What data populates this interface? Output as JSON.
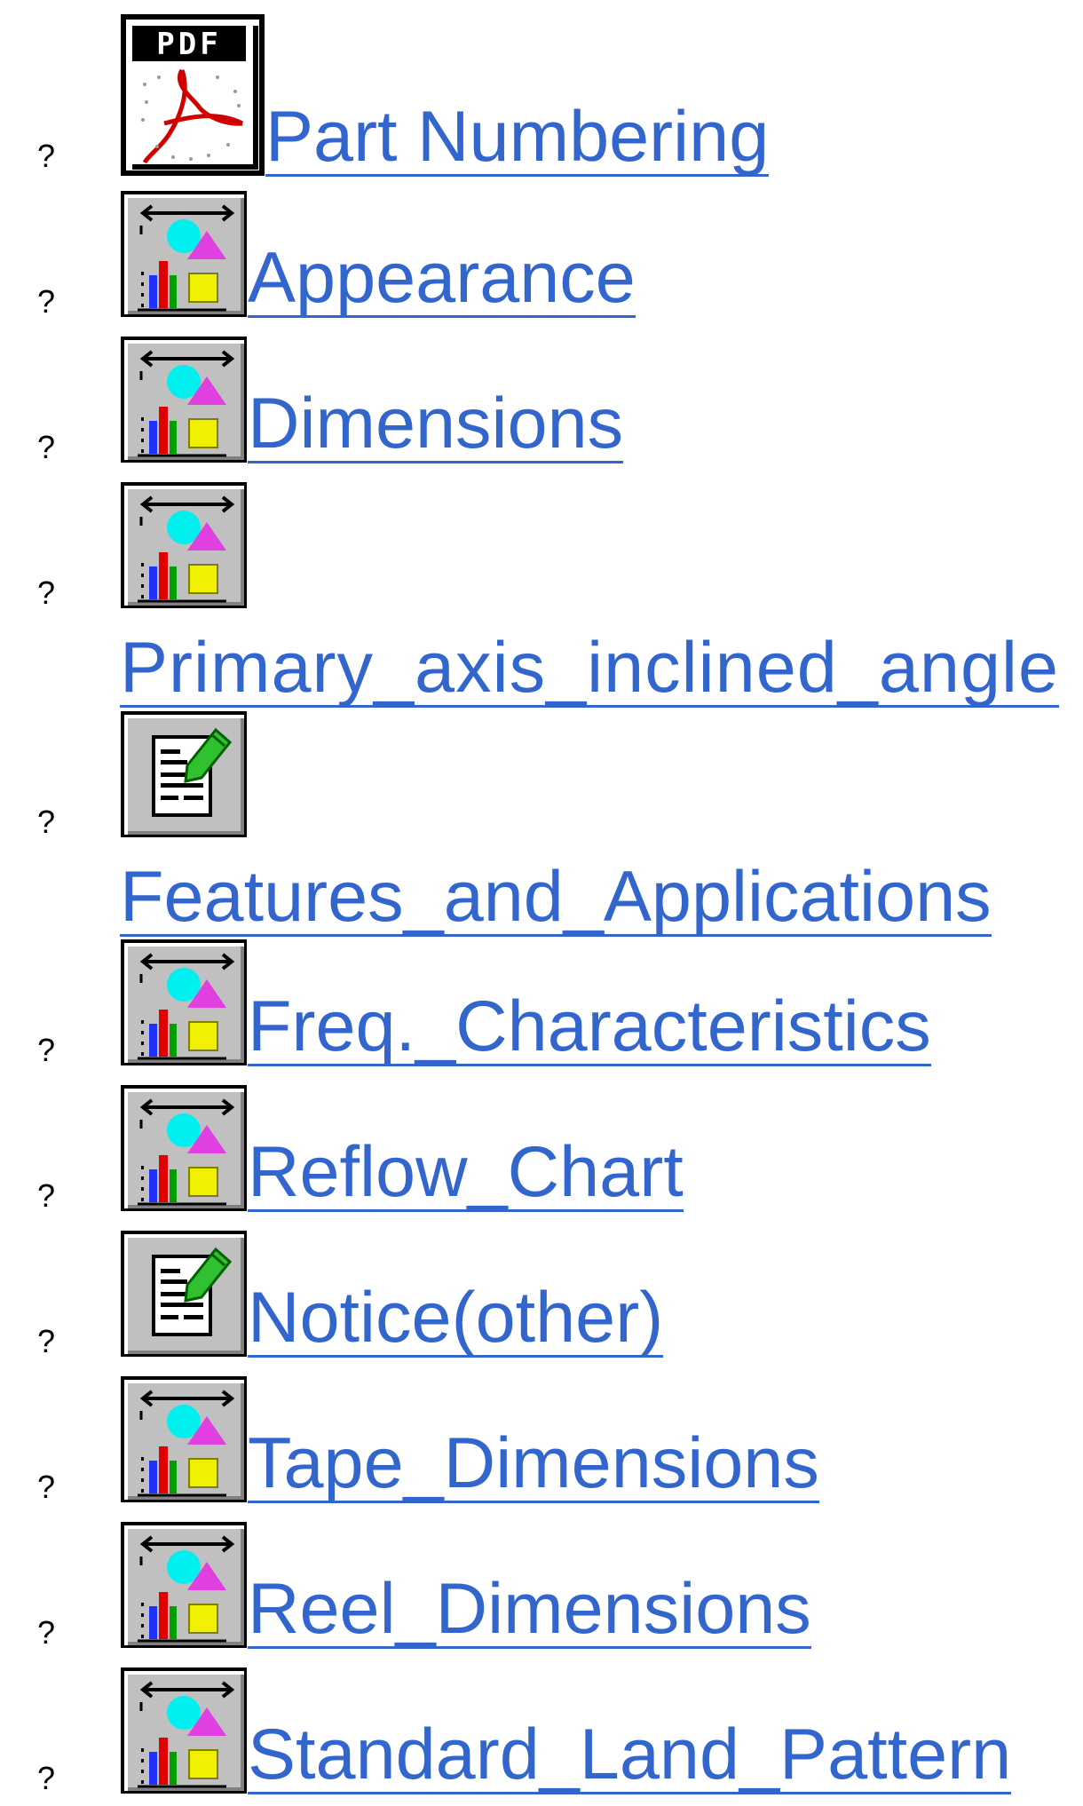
{
  "colors": {
    "link": "#3366cc",
    "bullet": "#000000",
    "icon_face": "#c0c0c0"
  },
  "items": [
    {
      "bullet": "?",
      "icon": "pdf-icon",
      "label": " Part Numbering"
    },
    {
      "bullet": "?",
      "icon": "chart-icon",
      "label": " Appearance"
    },
    {
      "bullet": "?",
      "icon": "chart-icon",
      "label": " Dimensions"
    },
    {
      "bullet": "?",
      "icon": "chart-icon",
      "label": "Primary_axis_inclined_angle"
    },
    {
      "bullet": "?",
      "icon": "document-edit-icon",
      "label": "Features_and_Applications "
    },
    {
      "bullet": "?",
      "icon": "chart-icon",
      "label": " Freq._Characteristics "
    },
    {
      "bullet": "?",
      "icon": "chart-icon",
      "label": " Reflow_Chart"
    },
    {
      "bullet": "?",
      "icon": "document-edit-icon",
      "label": " Notice(other)"
    },
    {
      "bullet": "?",
      "icon": "chart-icon",
      "label": " Tape_Dimensions "
    },
    {
      "bullet": "?",
      "icon": "chart-icon",
      "label": " Reel_Dimensions"
    },
    {
      "bullet": "?",
      "icon": "chart-icon",
      "label": " Standard_Land_Pattern "
    }
  ]
}
